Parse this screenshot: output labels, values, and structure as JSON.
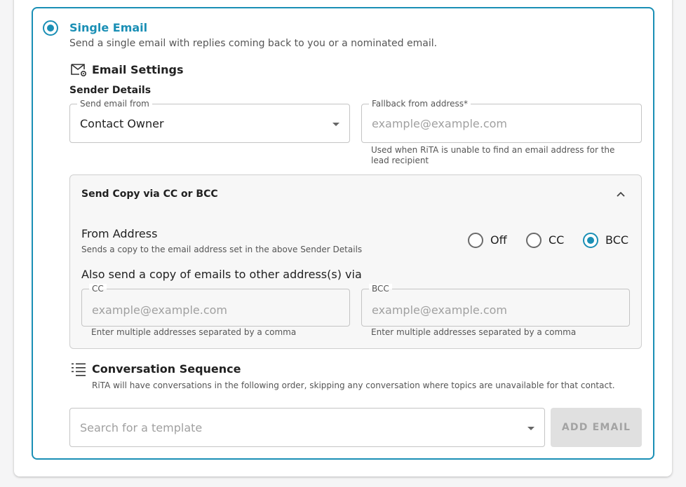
{
  "single_email": {
    "title": "Single Email",
    "description": "Send a single email with replies coming back to you or a nominated email."
  },
  "email_settings": {
    "heading": "Email Settings",
    "icon": "mail-settings-icon",
    "sender_details_label": "Sender Details",
    "send_from": {
      "label": "Send email from",
      "value": "Contact Owner"
    },
    "fallback": {
      "label": "Fallback from address*",
      "placeholder": "example@example.com",
      "help": "Used when RiTA is unable to find an email address for the lead recipient"
    }
  },
  "copy_panel": {
    "title": "Send Copy via CC or BCC",
    "from_address_label": "From Address",
    "from_address_help": "Sends a copy to the email address set in the above Sender Details",
    "options": [
      {
        "label": "Off",
        "selected": false
      },
      {
        "label": "CC",
        "selected": false
      },
      {
        "label": "BCC",
        "selected": true
      }
    ],
    "also_send_label": "Also send a copy of emails to other address(s) via",
    "cc": {
      "label": "CC",
      "placeholder": "example@example.com",
      "help": "Enter multiple addresses separated by a comma"
    },
    "bcc": {
      "label": "BCC",
      "placeholder": "example@example.com",
      "help": "Enter multiple addresses separated by a comma"
    }
  },
  "conversation": {
    "heading": "Conversation Sequence",
    "icon": "list-icon",
    "description": "RiTA will have conversations in the following order, skipping any conversation where topics are unavailable for that contact."
  },
  "template_search": {
    "placeholder": "Search for a template"
  },
  "add_email_label": "ADD EMAIL",
  "colors": {
    "accent": "#1a8fb5",
    "panel_bg": "#f7f7f7",
    "disabled_btn": "#e0e0e0"
  }
}
